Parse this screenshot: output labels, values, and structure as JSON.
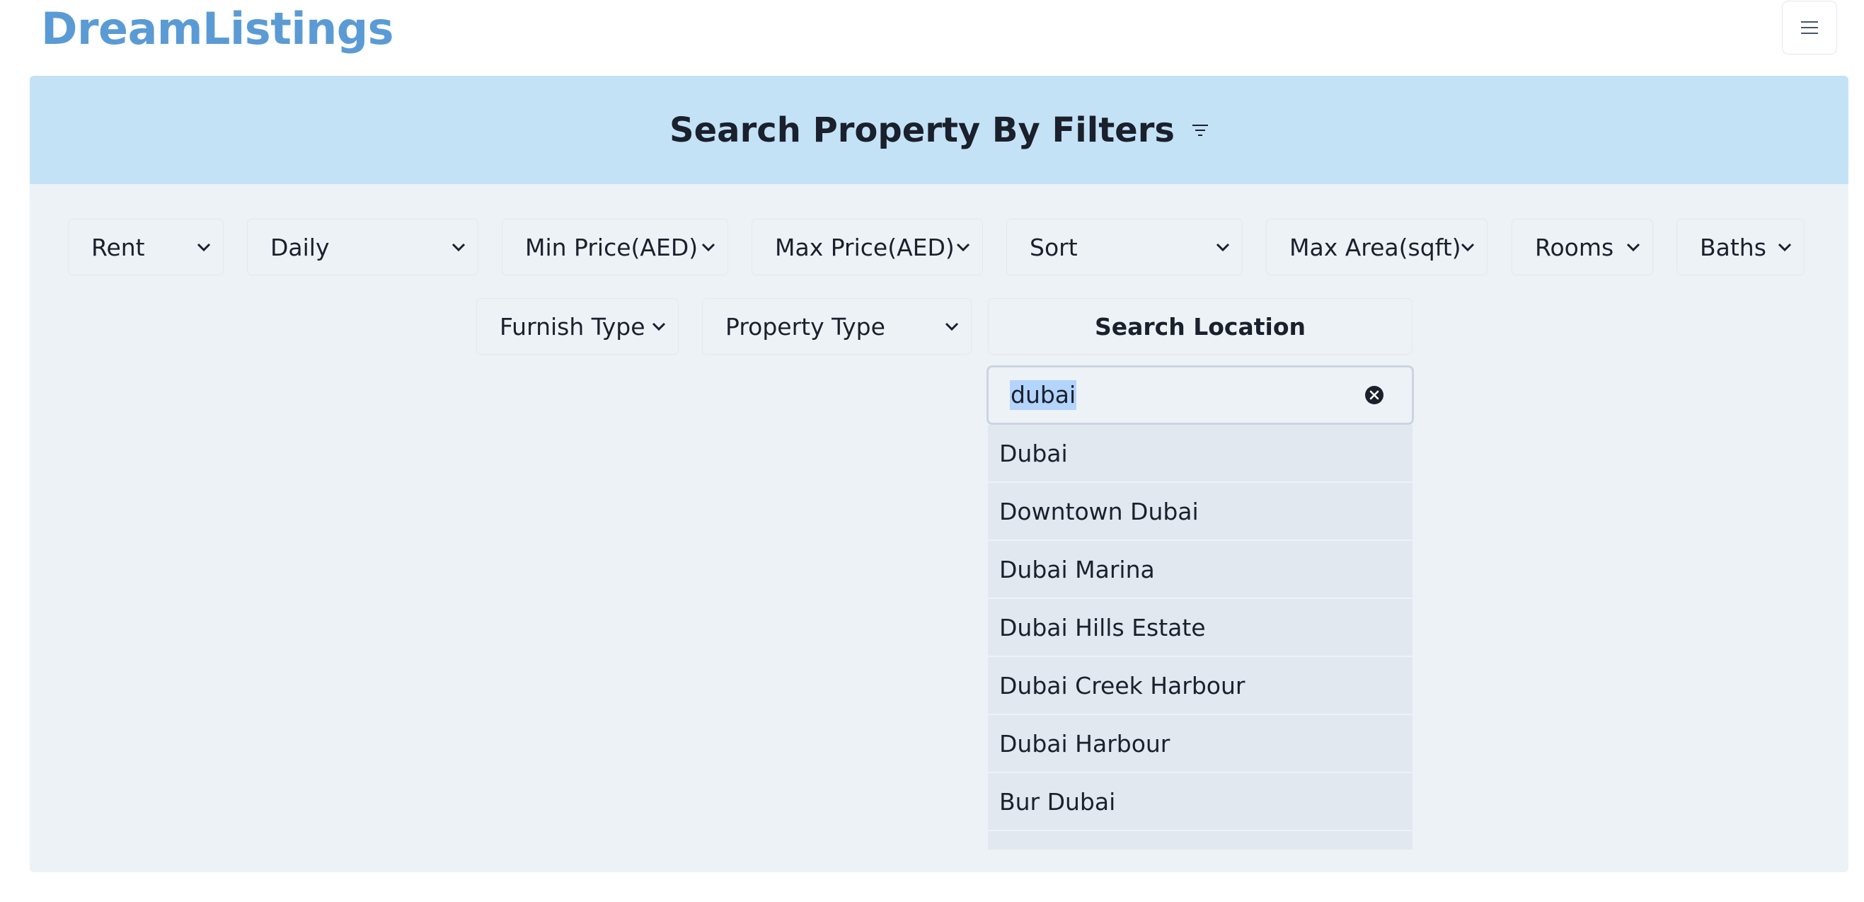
{
  "brand": "DreamListings",
  "header": {
    "menu_icon": "hamburger-menu-icon"
  },
  "panel": {
    "title": "Search Property By Filters",
    "title_icon": "filter-icon"
  },
  "filters": {
    "row1": [
      {
        "label": "Rent"
      },
      {
        "label": "Daily"
      },
      {
        "label": "Min Price(AED)"
      },
      {
        "label": "Max Price(AED)"
      },
      {
        "label": "Sort"
      },
      {
        "label": "Max Area(sqft)"
      },
      {
        "label": "Rooms"
      },
      {
        "label": "Baths"
      }
    ],
    "row2": [
      {
        "label": "Furnish Type"
      },
      {
        "label": "Property Type"
      }
    ],
    "search_location_label": "Search Location"
  },
  "location_search": {
    "value": "dubai",
    "clear_icon": "clear-circle-icon",
    "results": [
      "Dubai",
      "Downtown Dubai",
      "Dubai Marina",
      "Dubai Hills Estate",
      "Dubai Creek Harbour",
      "Dubai Harbour",
      "Bur Dubai",
      ""
    ]
  },
  "colors": {
    "brand": "#5b9bd5",
    "header_band": "#c4e2f6",
    "panel_bg": "#edf2f7",
    "selection": "#b3d4fc"
  }
}
